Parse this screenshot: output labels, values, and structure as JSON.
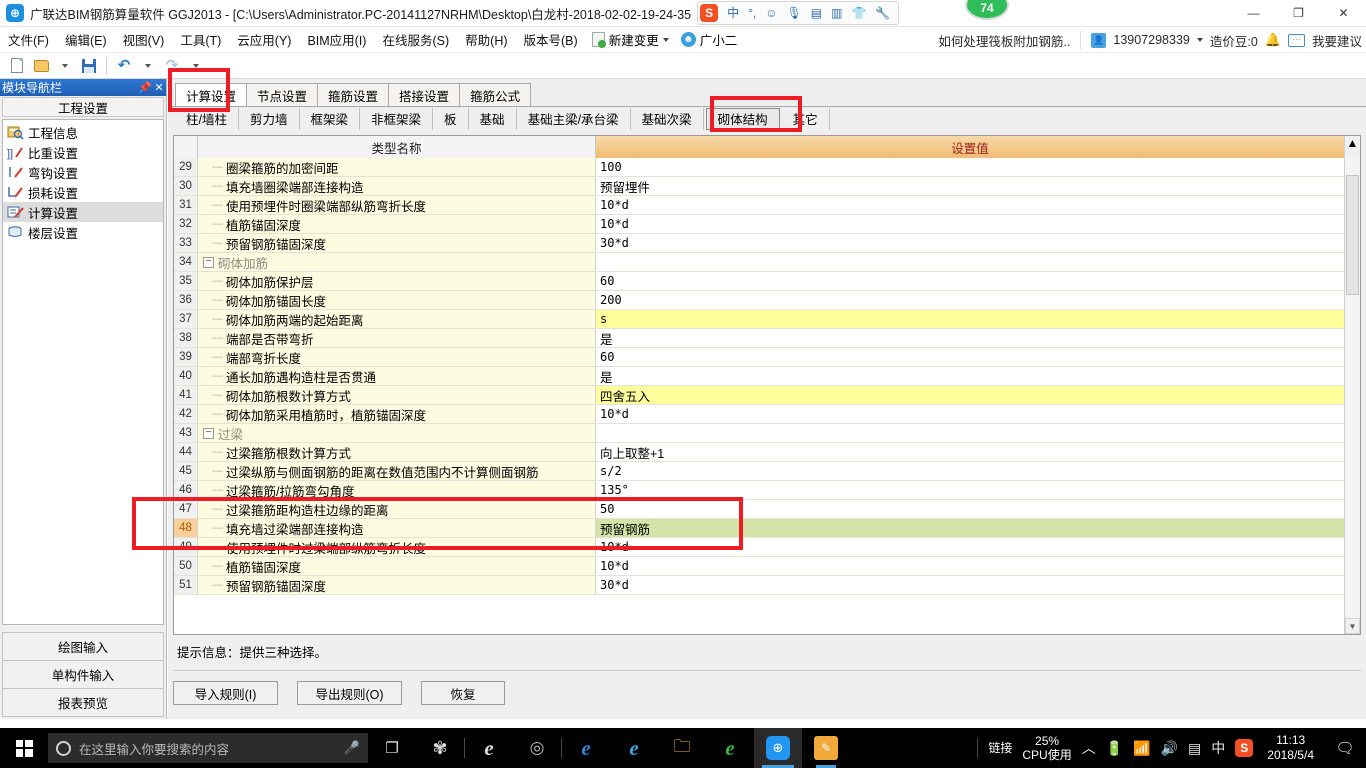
{
  "window": {
    "app_icon": "app-logo-icon",
    "title": "广联达BIM钢筋算量软件 GGJ2013 - [C:\\Users\\Administrator.PC-20141127NRHM\\Desktop\\白龙村-2018-02-02-19-24-35",
    "minimize": "—",
    "maximize": "❐",
    "close": "✕",
    "badge": "74"
  },
  "ime": {
    "logo": "S",
    "items": [
      "中",
      "°,",
      "☺",
      "🎤",
      "⌨",
      "📇",
      "👕",
      "🔧"
    ]
  },
  "menu": {
    "items": [
      "文件(F)",
      "编辑(E)",
      "视图(V)",
      "工具(T)",
      "云应用(Y)",
      "BIM应用(I)",
      "在线服务(S)",
      "帮助(H)",
      "版本号(B)"
    ],
    "new_change": "新建变更",
    "assistant": "广小二"
  },
  "account": {
    "question": "如何处理筏板附加钢筋..",
    "phone": "13907298339",
    "coins": "造价豆:0",
    "suggest": "我要建议"
  },
  "toolbar": {
    "new": "new-file-icon",
    "open": "open-folder-icon",
    "save": "save-icon",
    "undo": "undo-icon",
    "redo": "redo-icon"
  },
  "sidebar": {
    "header": "模块导航栏",
    "pin": "📌",
    "close": "✕",
    "group": "工程设置",
    "items": [
      {
        "label": "工程信息",
        "icon": "project-info-icon",
        "selected": false
      },
      {
        "label": "比重设置",
        "icon": "weight-settings-icon",
        "selected": false
      },
      {
        "label": "弯钩设置",
        "icon": "hook-settings-icon",
        "selected": false
      },
      {
        "label": "损耗设置",
        "icon": "loss-settings-icon",
        "selected": false
      },
      {
        "label": "计算设置",
        "icon": "calc-settings-icon",
        "selected": true
      },
      {
        "label": "楼层设置",
        "icon": "floor-settings-icon",
        "selected": false
      }
    ],
    "bottom_buttons": [
      "绘图输入",
      "单构件输入",
      "报表预览"
    ]
  },
  "tabs_primary": [
    {
      "label": "计算设置",
      "active": true
    },
    {
      "label": "节点设置",
      "active": false
    },
    {
      "label": "箍筋设置",
      "active": false
    },
    {
      "label": "搭接设置",
      "active": false
    },
    {
      "label": "箍筋公式",
      "active": false
    }
  ],
  "tabs_secondary": [
    {
      "label": "柱/墙柱",
      "active": false
    },
    {
      "label": "剪力墙",
      "active": false
    },
    {
      "label": "框架梁",
      "active": false
    },
    {
      "label": "非框架梁",
      "active": false
    },
    {
      "label": "板",
      "active": false
    },
    {
      "label": "基础",
      "active": false
    },
    {
      "label": "基础主梁/承台梁",
      "active": false
    },
    {
      "label": "基础次梁",
      "active": false
    },
    {
      "label": "砌体结构",
      "active": true
    },
    {
      "label": "其它",
      "active": false
    }
  ],
  "grid": {
    "columns": [
      "类型名称",
      "设置值"
    ],
    "rows": [
      {
        "num": "29",
        "name": "圈梁箍筋的加密间距",
        "value": "100",
        "kind": "leaf",
        "style": "plain"
      },
      {
        "num": "30",
        "name": "填充墙圈梁端部连接构造",
        "value": "预留埋件",
        "kind": "leaf",
        "style": "cjk"
      },
      {
        "num": "31",
        "name": "使用预埋件时圈梁端部纵筋弯折长度",
        "value": "10*d",
        "kind": "leaf",
        "style": "plain"
      },
      {
        "num": "32",
        "name": "植筋锚固深度",
        "value": "10*d",
        "kind": "leaf",
        "style": "plain"
      },
      {
        "num": "33",
        "name": "预留钢筋锚固深度",
        "value": "30*d",
        "kind": "leaf",
        "style": "plain"
      },
      {
        "num": "34",
        "name": "砌体加筋",
        "value": "",
        "kind": "group",
        "style": "plain"
      },
      {
        "num": "35",
        "name": "砌体加筋保护层",
        "value": "60",
        "kind": "leaf",
        "style": "plain"
      },
      {
        "num": "36",
        "name": "砌体加筋锚固长度",
        "value": "200",
        "kind": "leaf",
        "style": "plain"
      },
      {
        "num": "37",
        "name": "砌体加筋两端的起始距离",
        "value": "s",
        "kind": "leaf",
        "style": "highlight"
      },
      {
        "num": "38",
        "name": "端部是否带弯折",
        "value": "是",
        "kind": "leaf",
        "style": "cjk"
      },
      {
        "num": "39",
        "name": "端部弯折长度",
        "value": "60",
        "kind": "leaf",
        "style": "plain"
      },
      {
        "num": "40",
        "name": "通长加筋遇构造柱是否贯通",
        "value": "是",
        "kind": "leaf",
        "style": "cjk"
      },
      {
        "num": "41",
        "name": "砌体加筋根数计算方式",
        "value": "四舍五入",
        "kind": "leaf",
        "style": "highlight-cjk"
      },
      {
        "num": "42",
        "name": "砌体加筋采用植筋时，植筋锚固深度",
        "value": "10*d",
        "kind": "leaf",
        "style": "plain"
      },
      {
        "num": "43",
        "name": "过梁",
        "value": "",
        "kind": "group",
        "style": "plain"
      },
      {
        "num": "44",
        "name": "过梁箍筋根数计算方式",
        "value": "向上取整+1",
        "kind": "leaf",
        "style": "cjk"
      },
      {
        "num": "45",
        "name": "过梁纵筋与侧面钢筋的距离在数值范围内不计算侧面钢筋",
        "value": "s/2",
        "kind": "leaf",
        "style": "plain"
      },
      {
        "num": "46",
        "name": "过梁箍筋/拉筋弯勾角度",
        "value": "135°",
        "kind": "leaf",
        "style": "plain"
      },
      {
        "num": "47",
        "name": "过梁箍筋距构造柱边缘的距离",
        "value": "50",
        "kind": "leaf",
        "style": "plain"
      },
      {
        "num": "48",
        "name": "填充墙过梁端部连接构造",
        "value": "预留钢筋",
        "kind": "leaf",
        "style": "current"
      },
      {
        "num": "49",
        "name": "使用预埋件时过梁端部纵筋弯折长度",
        "value": "10*d",
        "kind": "leaf",
        "style": "plain"
      },
      {
        "num": "50",
        "name": "植筋锚固深度",
        "value": "10*d",
        "kind": "leaf",
        "style": "plain"
      },
      {
        "num": "51",
        "name": "预留钢筋锚固深度",
        "value": "30*d",
        "kind": "leaf",
        "style": "plain"
      }
    ]
  },
  "hint": "提示信息：提供三种选择。",
  "dialog_buttons": [
    "导入规则(I)",
    "导出规则(O)",
    "恢复"
  ],
  "taskbar": {
    "search_placeholder": "在这里输入你要搜索的内容",
    "tray_link": "链接",
    "cpu_percent": "25%",
    "cpu_label": "CPU使用",
    "ime_lang": "中",
    "time": "11:13",
    "date": "2018/5/4"
  },
  "colors": {
    "accent": "#1e5fb5",
    "annotation": "#ee1c24",
    "value_header": "#f0bc72",
    "row_bg": "#fdfbe0",
    "highlight": "#ffff9e",
    "current_row": "#d5e3a8"
  }
}
